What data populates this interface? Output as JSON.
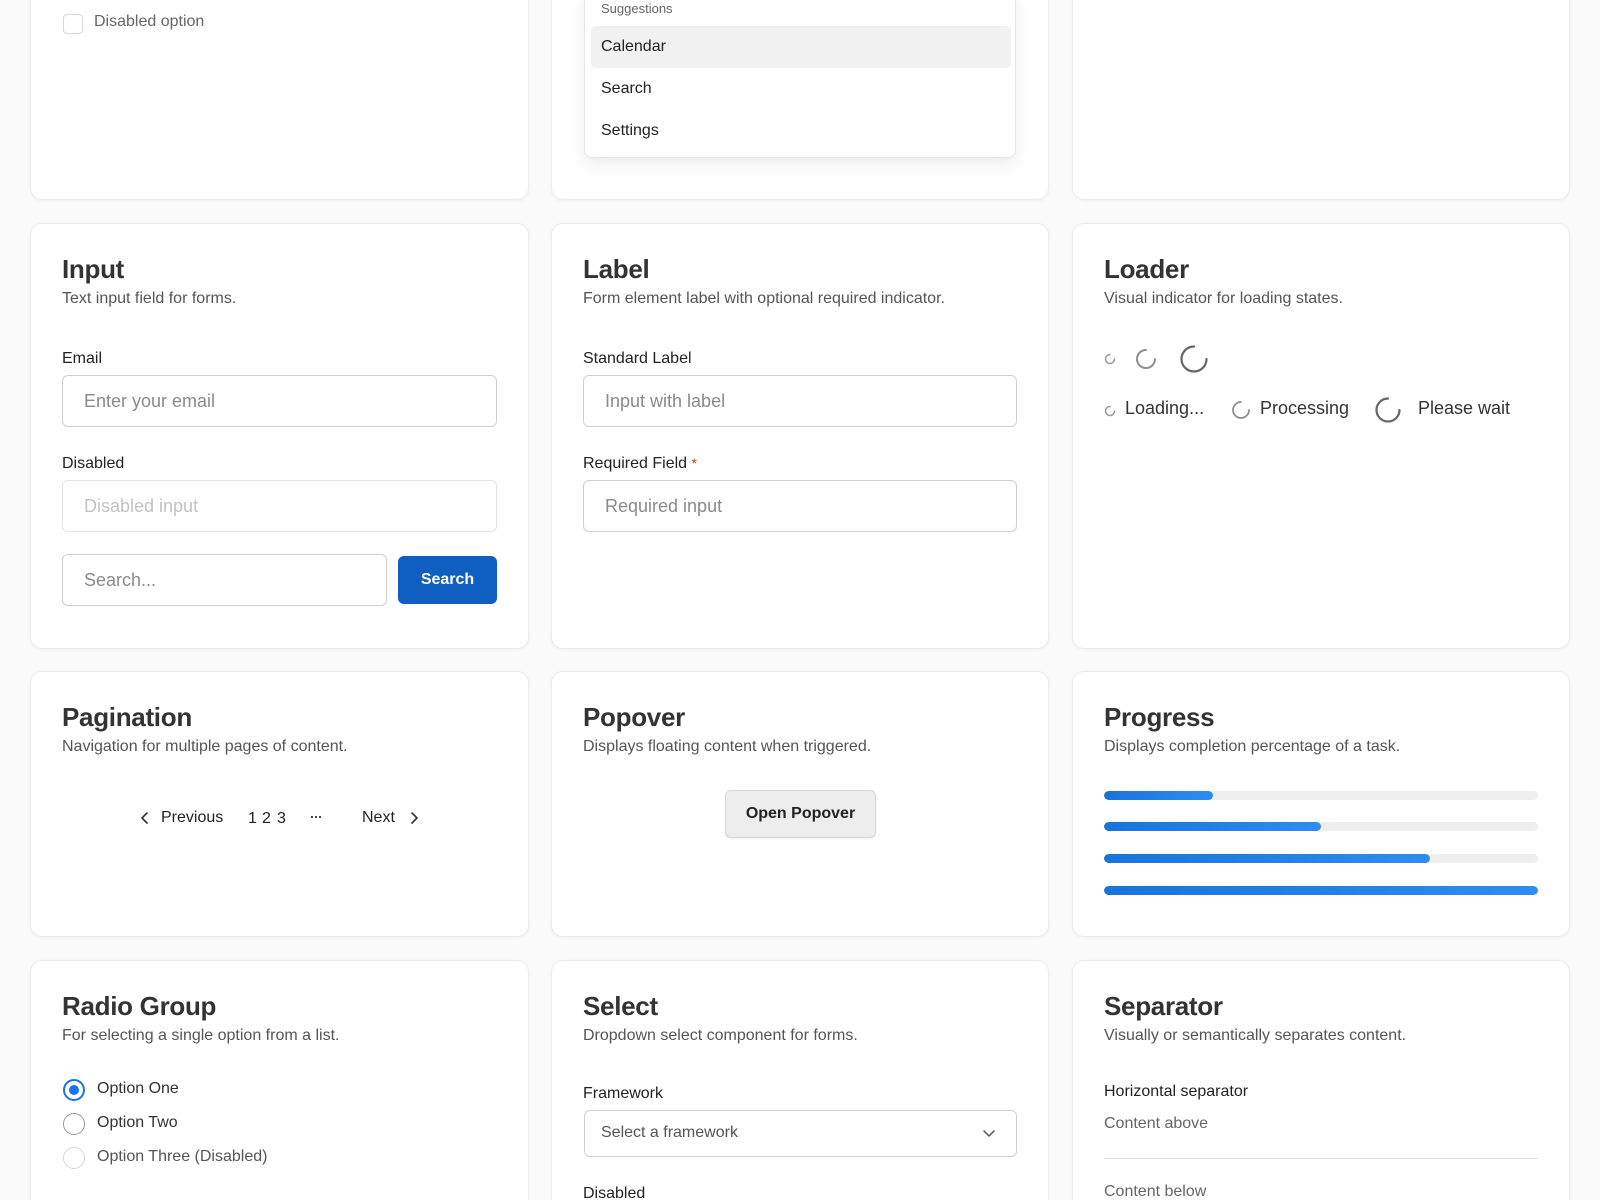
{
  "checkbox": {
    "disabled_label": "Disabled option"
  },
  "suggestions": {
    "heading": "Suggestions",
    "items": [
      "Calendar",
      "Search",
      "Settings"
    ]
  },
  "input_card": {
    "title": "Input",
    "description": "Text input field for forms.",
    "email_label": "Email",
    "email_placeholder": "Enter your email",
    "disabled_label": "Disabled",
    "disabled_placeholder": "Disabled input",
    "search_placeholder": "Search...",
    "search_button": "Search"
  },
  "label_card": {
    "title": "Label",
    "description": "Form element label with optional required indicator.",
    "standard_label": "Standard Label",
    "standard_placeholder": "Input with label",
    "required_label": "Required Field",
    "required_marker": "*",
    "required_placeholder": "Required input"
  },
  "loader_card": {
    "title": "Loader",
    "description": "Visual indicator for loading states.",
    "labels": [
      "Loading...",
      "Processing",
      "Please wait"
    ]
  },
  "pagination_card": {
    "title": "Pagination",
    "description": "Navigation for multiple pages of content.",
    "previous": "Previous",
    "pages": [
      "1",
      "2",
      "3"
    ],
    "ellipsis": "···",
    "next": "Next"
  },
  "popover_card": {
    "title": "Popover",
    "description": "Displays floating content when triggered.",
    "button": "Open Popover"
  },
  "progress_card": {
    "title": "Progress",
    "description": "Displays completion percentage of a task.",
    "values": [
      25,
      50,
      75,
      100
    ]
  },
  "radio_card": {
    "title": "Radio Group",
    "description": "For selecting a single option from a list.",
    "options": [
      "Option One",
      "Option Two",
      "Option Three (Disabled)"
    ],
    "selected_index": 0
  },
  "select_card": {
    "title": "Select",
    "description": "Dropdown select component for forms.",
    "framework_label": "Framework",
    "framework_placeholder": "Select a framework",
    "disabled_label": "Disabled"
  },
  "separator_card": {
    "title": "Separator",
    "description": "Visually or semantically separates content.",
    "horizontal_label": "Horizontal separator",
    "content_above": "Content above",
    "content_below": "Content below"
  },
  "colors": {
    "primary": "#0f5fc2",
    "accent": "#1a73e8",
    "required": "#d93025"
  }
}
